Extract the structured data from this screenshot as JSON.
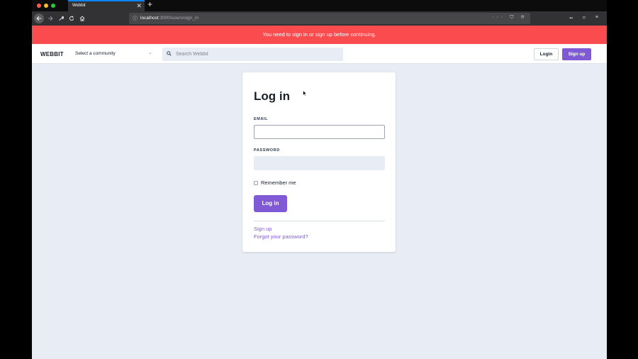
{
  "browser": {
    "tab_title": "Webbit",
    "tab_close": "✕",
    "new_tab": "+",
    "url_host": "localhost",
    "url_path": ":3000/users/sign_in",
    "url_actions": "··· ⛉ ☆",
    "toolbar_right": "⑉ ▭ ≡",
    "traffic_colors": [
      "#ff5f57",
      "#febc2e",
      "#28c840"
    ]
  },
  "flash": {
    "message": "You need to sign in or sign up before continuing."
  },
  "header": {
    "logo": "WEBBIT",
    "community_select": "Select a community",
    "search_placeholder": "Search Webbit",
    "login_label": "Login",
    "signup_label": "Sign up"
  },
  "form": {
    "title": "Log in",
    "email_label": "EMAIL",
    "email_value": "",
    "password_label": "PASSWORD",
    "password_value": "",
    "remember_label": "Remember me",
    "submit_label": "Log in",
    "signup_link": "Sign up",
    "forgot_link": "Forgot your password?"
  },
  "colors": {
    "accent": "#805ad5",
    "flash_bg": "#fa4b4e",
    "page_bg": "#e8edf5"
  }
}
